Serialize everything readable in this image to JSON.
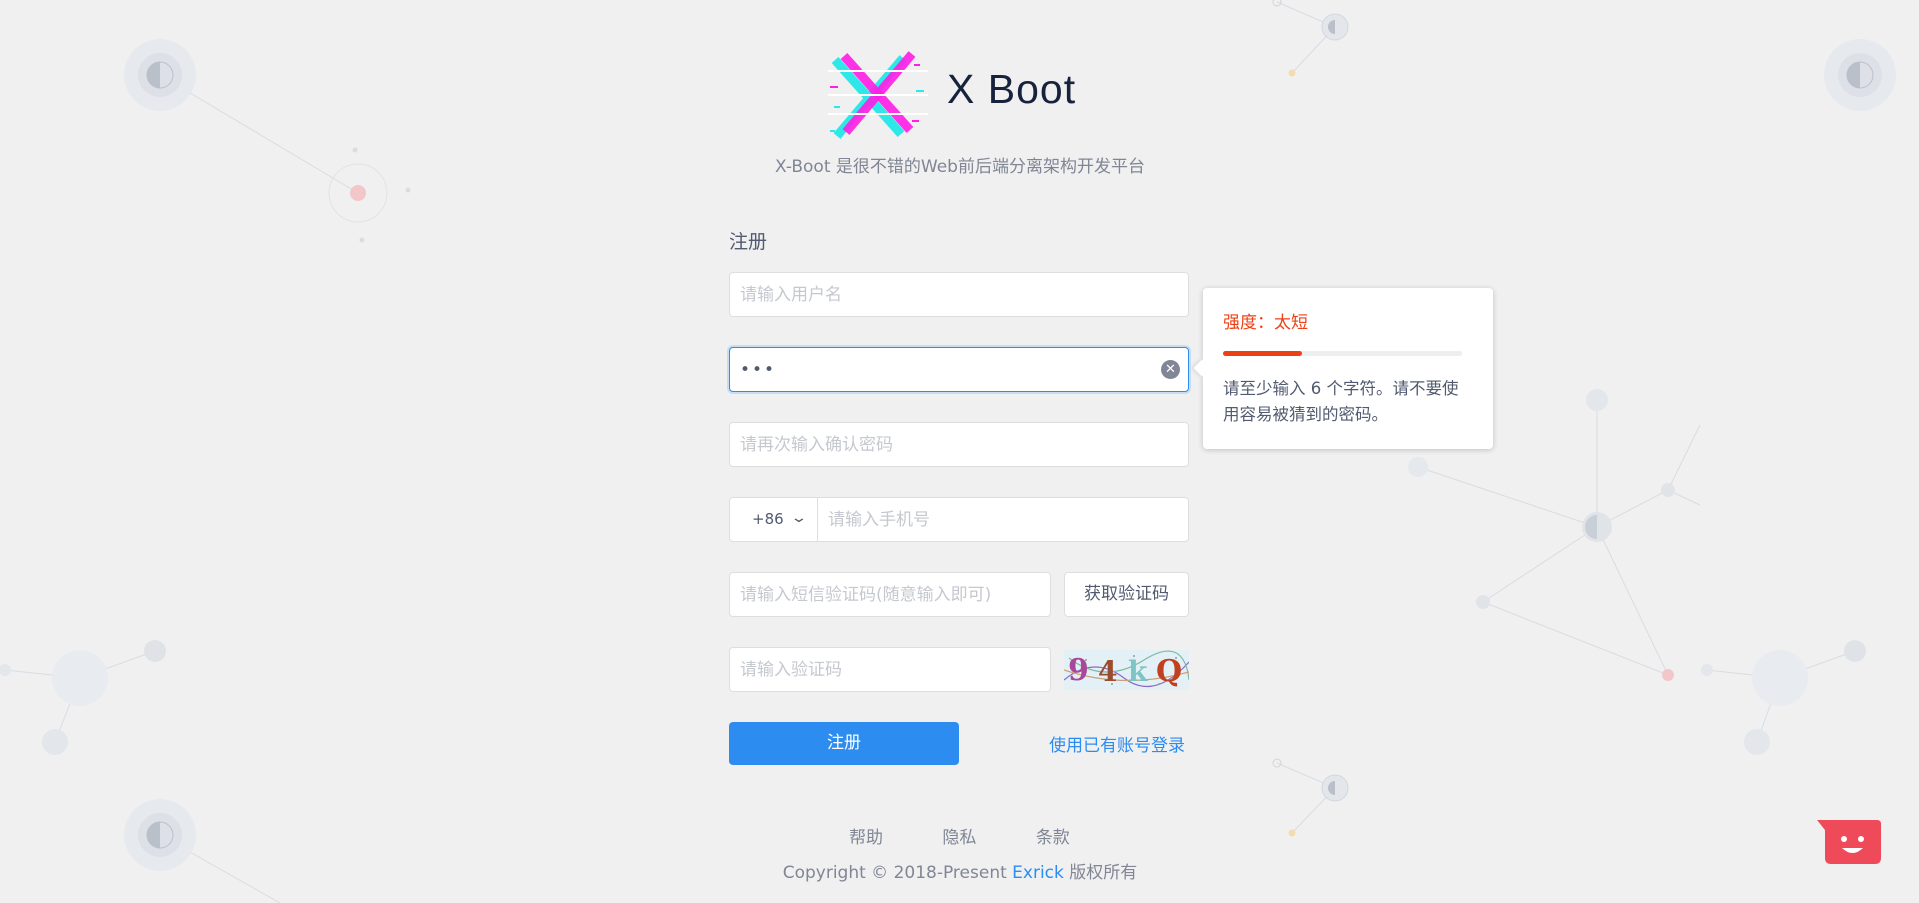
{
  "brand": {
    "name": "X Boot",
    "subtitle": "X-Boot 是很不错的Web前后端分离架构开发平台"
  },
  "form": {
    "title": "注册",
    "username_placeholder": "请输入用户名",
    "password_value": "•••",
    "confirm_placeholder": "请再次输入确认密码",
    "country_code": "+86",
    "phone_placeholder": "请输入手机号",
    "sms_placeholder": "请输入短信验证码(随意输入即可)",
    "sms_button": "获取验证码",
    "captcha_placeholder": "请输入验证码",
    "captcha_text": "94kQ",
    "register_button": "注册",
    "login_link": "使用已有账号登录"
  },
  "password_strength": {
    "label": "强度：太短",
    "level": 0.33,
    "message": "请至少输入 6 个字符。请不要使用容易被猜到的密码。",
    "color": "#ed4014"
  },
  "footer": {
    "links": [
      "帮助",
      "隐私",
      "条款"
    ],
    "copyright_prefix": "Copyright © 2018-Present",
    "author": "Exrick",
    "copyright_suffix": "版权所有"
  },
  "colors": {
    "primary": "#2d8cf0",
    "error": "#ed4014",
    "chat_widget": "#ef4a5a"
  }
}
